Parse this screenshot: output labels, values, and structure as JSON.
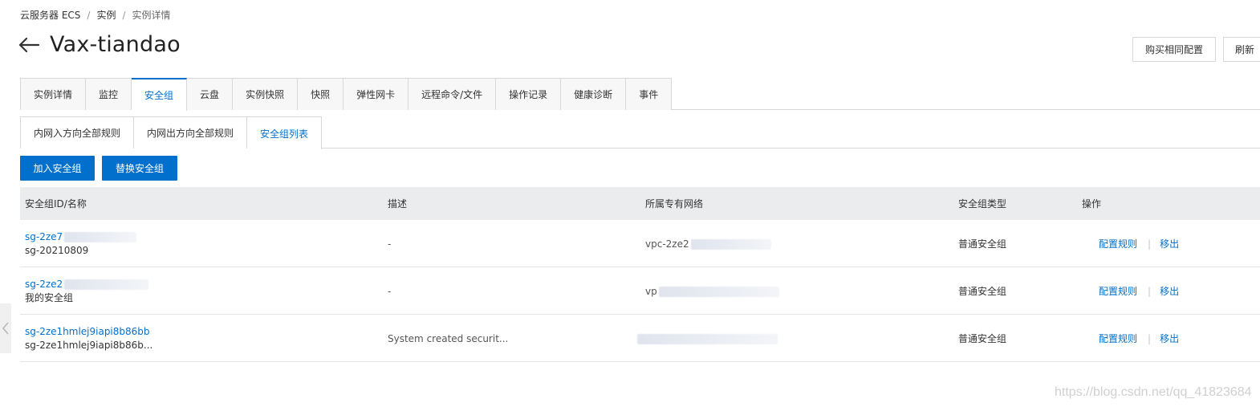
{
  "breadcrumb": {
    "root": "云服务器 ECS",
    "mid": "实例",
    "current": "实例详情",
    "sep": "/"
  },
  "page": {
    "title": "Vax-tiandao"
  },
  "actions": {
    "buy_same": "购买相同配置",
    "refresh": "刷新"
  },
  "main_tabs": [
    {
      "label": "实例详情"
    },
    {
      "label": "监控"
    },
    {
      "label": "安全组"
    },
    {
      "label": "云盘"
    },
    {
      "label": "实例快照"
    },
    {
      "label": "快照"
    },
    {
      "label": "弹性网卡"
    },
    {
      "label": "远程命令/文件"
    },
    {
      "label": "操作记录"
    },
    {
      "label": "健康诊断"
    },
    {
      "label": "事件"
    }
  ],
  "sub_tabs": [
    {
      "label": "内网入方向全部规则"
    },
    {
      "label": "内网出方向全部规则"
    },
    {
      "label": "安全组列表"
    }
  ],
  "buttons": {
    "join": "加入安全组",
    "replace": "替换安全组"
  },
  "table": {
    "headers": {
      "id_name": "安全组ID/名称",
      "desc": "描述",
      "vpc": "所属专有网络",
      "type": "安全组类型",
      "ops": "操作"
    },
    "rows": [
      {
        "id": "sg-2ze7",
        "name": "sg-20210809",
        "desc": "-",
        "vpc": "vpc-2ze2",
        "type": "普通安全组",
        "op_config": "配置规则",
        "op_remove": "移出"
      },
      {
        "id": "sg-2ze2",
        "name": "我的安全组",
        "desc": "-",
        "vpc": "vp",
        "type": "普通安全组",
        "op_config": "配置规则",
        "op_remove": "移出"
      },
      {
        "id": "sg-2ze1hmlej9iapi8b86bb",
        "name": "sg-2ze1hmlej9iapi8b86b...",
        "desc": "System created securit...",
        "vpc": "",
        "type": "普通安全组",
        "op_config": "配置规则",
        "op_remove": "移出"
      }
    ],
    "op_separator": "|"
  },
  "watermark": "https://blog.csdn.net/qq_41823684"
}
